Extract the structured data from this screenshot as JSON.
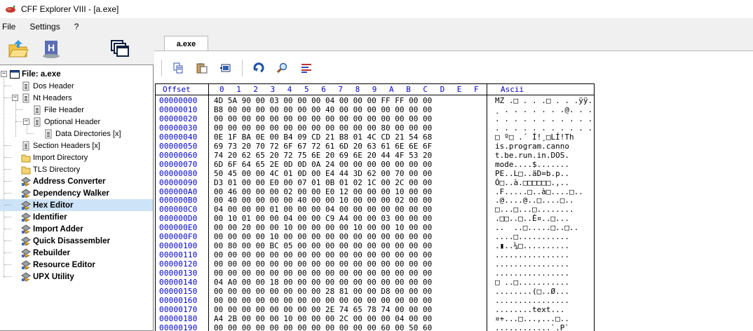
{
  "window": {
    "title": "CFF Explorer VIII - [a.exe]",
    "app_icon": "red-pepper-icon"
  },
  "menu": [
    "File",
    "Settings",
    "?"
  ],
  "tree": {
    "items": [
      {
        "label": "File: a.exe",
        "icon": "window-icon",
        "bold": true,
        "depth": 0
      },
      {
        "label": "Dos Header",
        "icon": "document-icon",
        "depth": 1
      },
      {
        "label": "Nt Headers",
        "icon": "document-icon",
        "depth": 1
      },
      {
        "label": "File Header",
        "icon": "document-icon",
        "depth": 2
      },
      {
        "label": "Optional Header",
        "icon": "document-icon",
        "depth": 2
      },
      {
        "label": "Data Directories [x]",
        "icon": "document-icon",
        "depth": 3
      },
      {
        "label": "Section Headers [x]",
        "icon": "document-icon",
        "depth": 1
      },
      {
        "label": "Import Directory",
        "icon": "folder-icon",
        "depth": 1
      },
      {
        "label": "TLS Directory",
        "icon": "folder-icon",
        "depth": 1
      },
      {
        "label": "Address Converter",
        "icon": "tool-icon",
        "bold": true,
        "depth": 1
      },
      {
        "label": "Dependency Walker",
        "icon": "tool-icon",
        "bold": true,
        "depth": 1
      },
      {
        "label": "Hex Editor",
        "icon": "tool-icon",
        "bold": true,
        "depth": 1,
        "selected": true
      },
      {
        "label": "Identifier",
        "icon": "tool-icon",
        "bold": true,
        "depth": 1
      },
      {
        "label": "Import Adder",
        "icon": "tool-icon",
        "bold": true,
        "depth": 1
      },
      {
        "label": "Quick Disassembler",
        "icon": "tool-icon",
        "bold": true,
        "depth": 1
      },
      {
        "label": "Rebuilder",
        "icon": "tool-icon",
        "bold": true,
        "depth": 1
      },
      {
        "label": "Resource Editor",
        "icon": "tool-icon",
        "bold": true,
        "depth": 1
      },
      {
        "label": "UPX Utility",
        "icon": "tool-icon",
        "bold": true,
        "depth": 1
      }
    ]
  },
  "tab": {
    "label": "a.exe"
  },
  "toolbar_icons": [
    "copy-icon",
    "paste-icon",
    "fill-icon",
    "goto-offset-icon",
    "search-icon",
    "select-range-icon"
  ],
  "hex": {
    "header_offset": "Offset",
    "header_cols": [
      "0",
      "1",
      "2",
      "3",
      "4",
      "5",
      "6",
      "7",
      "8",
      "9",
      "A",
      "B",
      "C",
      "D",
      "E",
      "F"
    ],
    "header_ascii": "Ascii",
    "rows": [
      {
        "offset": "00000000",
        "bytes": "4D 5A 90 00 03 00 00 00 04 00 00 00 FF FF 00 00",
        "ascii": "MZ .□ . . .□ . . .ÿÿ. ."
      },
      {
        "offset": "00000010",
        "bytes": "B8 00 00 00 00 00 00 00 40 00 00 00 00 00 00 00",
        "ascii": "¸ . . . . . . .@. . . . . . ."
      },
      {
        "offset": "00000020",
        "bytes": "00 00 00 00 00 00 00 00 00 00 00 00 00 00 00 00",
        "ascii": ". . . . . . . . . . . . . . . ."
      },
      {
        "offset": "00000030",
        "bytes": "00 00 00 00 00 00 00 00 00 00 00 00 80 00 00 00",
        "ascii": ". . . . . . . . . . . .▮. . ."
      },
      {
        "offset": "00000040",
        "bytes": "0E 1F BA 0E 00 B4 09 CD 21 B8 01 4C CD 21 54 68",
        "ascii": "□ º□ .´ Í!¸□LÍ!Th"
      },
      {
        "offset": "00000050",
        "bytes": "69 73 20 70 72 6F 67 72 61 6D 20 63 61 6E 6E 6F",
        "ascii": "is.program.canno"
      },
      {
        "offset": "00000060",
        "bytes": "74 20 62 65 20 72 75 6E 20 69 6E 20 44 4F 53 20",
        "ascii": "t.be.run.in.DOS."
      },
      {
        "offset": "00000070",
        "bytes": "6D 6F 64 65 2E 0D 0D 0A 24 00 00 00 00 00 00 00",
        "ascii": "mode....$......."
      },
      {
        "offset": "00000080",
        "bytes": "50 45 00 00 4C 01 0D 00 E4 44 3D 62 00 70 00 00",
        "ascii": "PE..L□..äD=b.p.."
      },
      {
        "offset": "00000090",
        "bytes": "D3 01 00 00 E0 00 07 01 0B 01 02 1C 00 2C 00 00",
        "ascii": "Ó□..à.□□□□□□.,.."
      },
      {
        "offset": "000000A0",
        "bytes": "00 46 00 00 00 02 00 00 E0 12 00 00 00 10 00 00",
        "ascii": ".F.....□..à□....□.."
      },
      {
        "offset": "000000B0",
        "bytes": "00 40 00 00 00 00 40 00 00 10 00 00 00 02 00 00",
        "ascii": ".@....@..□....□.."
      },
      {
        "offset": "000000C0",
        "bytes": "04 00 00 00 01 00 00 00 04 00 00 00 00 00 00 00",
        "ascii": "□...□...□........"
      },
      {
        "offset": "000000D0",
        "bytes": "00 10 01 00 00 04 00 00 C9 A4 00 00 03 00 00 00",
        "ascii": ".□□..□..É¤..□..."
      },
      {
        "offset": "000000E0",
        "bytes": "00 00 20 00 00 10 00 00 00 00 10 00 00 10 00 00",
        "ascii": "..  ..□.....□..□.."
      },
      {
        "offset": "000000F0",
        "bytes": "00 00 00 00 10 00 00 00 00 00 00 00 00 00 00 00",
        "ascii": "....□..........."
      },
      {
        "offset": "00000100",
        "bytes": "00 80 00 00 BC 05 00 00 00 00 00 00 00 00 00 00",
        "ascii": ".▮..¼□.........."
      },
      {
        "offset": "00000110",
        "bytes": "00 00 00 00 00 00 00 00 00 00 00 00 00 00 00 00",
        "ascii": "................"
      },
      {
        "offset": "00000120",
        "bytes": "00 00 00 00 00 00 00 00 00 00 00 00 00 00 00 00",
        "ascii": "................"
      },
      {
        "offset": "00000130",
        "bytes": "00 00 00 00 00 00 00 00 00 00 00 00 00 00 00 00",
        "ascii": "................"
      },
      {
        "offset": "00000140",
        "bytes": "04 A0 00 00 18 00 00 00 00 00 00 00 00 00 00 00",
        "ascii": "□ ..□..........."
      },
      {
        "offset": "00000150",
        "bytes": "00 00 00 00 00 00 00 00 28 81 00 00 D8 00 00 00",
        "ascii": "........(□..Ø..."
      },
      {
        "offset": "00000160",
        "bytes": "00 00 00 00 00 00 00 00 00 00 00 00 00 00 00 00",
        "ascii": "................"
      },
      {
        "offset": "00000170",
        "bytes": "00 00 00 00 00 00 00 00 2E 74 65 78 74 00 00 00",
        "ascii": "........text..."
      },
      {
        "offset": "00000180",
        "bytes": "A4 2B 00 00 00 10 00 00 00 2C 00 00 00 04 00 00",
        "ascii": "¤+...□...,...□.."
      },
      {
        "offset": "00000190",
        "bytes": "00 00 00 00 00 00 00 00 00 00 00 00 60 00 50 60",
        "ascii": "............`.P`"
      }
    ]
  },
  "colors": {
    "offset_blue": "#0000cc",
    "selection": "#cde3f7",
    "border": "#000000"
  }
}
